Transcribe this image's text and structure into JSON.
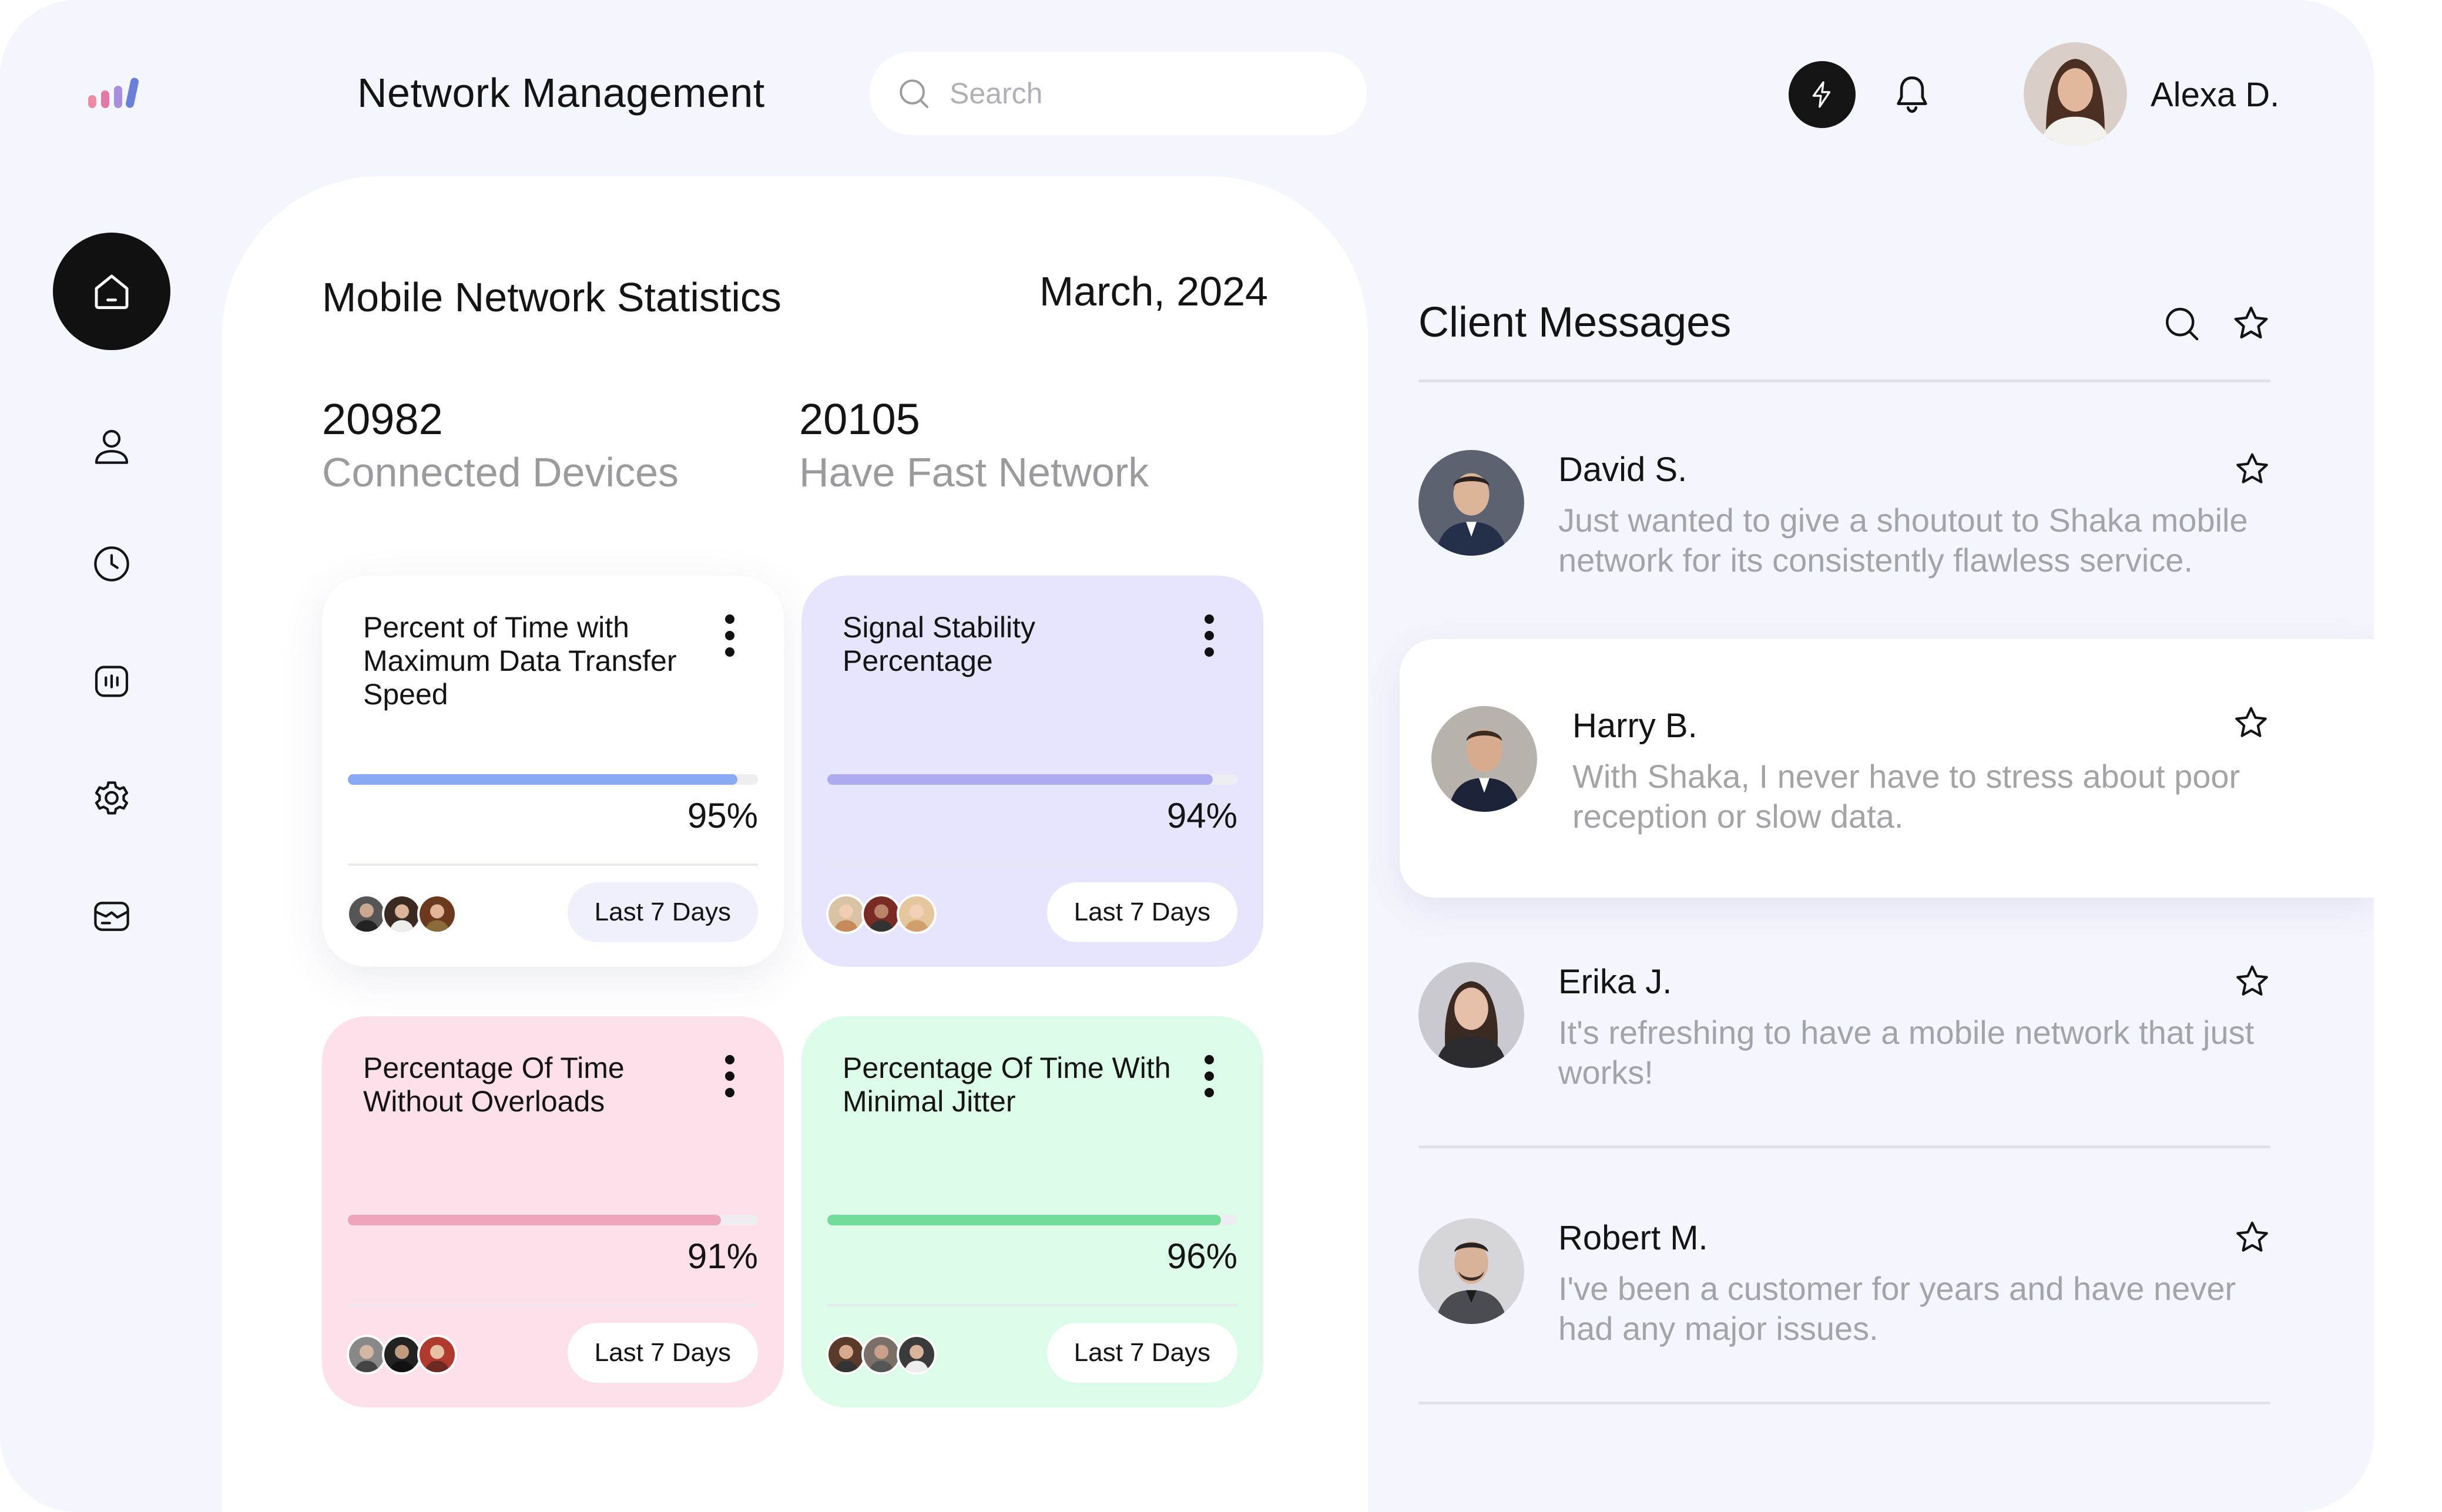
{
  "header": {
    "title": "Network Management",
    "search_placeholder": "Search",
    "user_name": "Alexa D."
  },
  "sidebar": {
    "items": [
      {
        "name": "home",
        "active": true
      },
      {
        "name": "user",
        "active": false
      },
      {
        "name": "clock",
        "active": false
      },
      {
        "name": "stats",
        "active": false
      },
      {
        "name": "settings",
        "active": false
      },
      {
        "name": "messages",
        "active": false
      }
    ]
  },
  "stats": {
    "title": "Mobile Network Statistics",
    "date": "March, 2024",
    "connected": {
      "value": "20982",
      "label": "Connected Devices"
    },
    "fast": {
      "value": "20105",
      "label": "Have Fast Network"
    },
    "cards": [
      {
        "title": "Percent of Time with Maximum Data Transfer Speed",
        "percent_text": "95%",
        "percent": 95,
        "range": "Last 7 Days",
        "bar_color": "#8aa9f5",
        "bg_color": "#ffffff"
      },
      {
        "title": "Signal Stability Percentage",
        "percent_text": "94%",
        "percent": 94,
        "range": "Last 7 Days",
        "bar_color": "#aeaaf0",
        "bg_color": "#e7e5fd"
      },
      {
        "title": "Percentage Of Time Without Overloads",
        "percent_text": "91%",
        "percent": 91,
        "range": "Last 7 Days",
        "bar_color": "#eea4bb",
        "bg_color": "#fde0ea"
      },
      {
        "title": "Percentage Of Time With Minimal Jitter",
        "percent_text": "96%",
        "percent": 96,
        "range": "Last 7 Days",
        "bar_color": "#73dc9a",
        "bg_color": "#dcfbe9"
      }
    ]
  },
  "messages": {
    "title": "Client Messages",
    "items": [
      {
        "name": "David S.",
        "text": "Just wanted to give a shoutout to Shaka mobile network for its consistently flawless service."
      },
      {
        "name": "Harry B.",
        "text": "With Shaka, I never have to stress about poor reception or slow data."
      },
      {
        "name": "Erika J.",
        "text": "It's refreshing to have a mobile network that just works!"
      },
      {
        "name": "Robert M.",
        "text": "I've been a customer for years and have never had any major issues."
      }
    ]
  },
  "colors": {
    "background": "#f4f6fd",
    "panel": "#ffffff",
    "dark": "#111111",
    "muted_text": "#9b9b9f"
  }
}
